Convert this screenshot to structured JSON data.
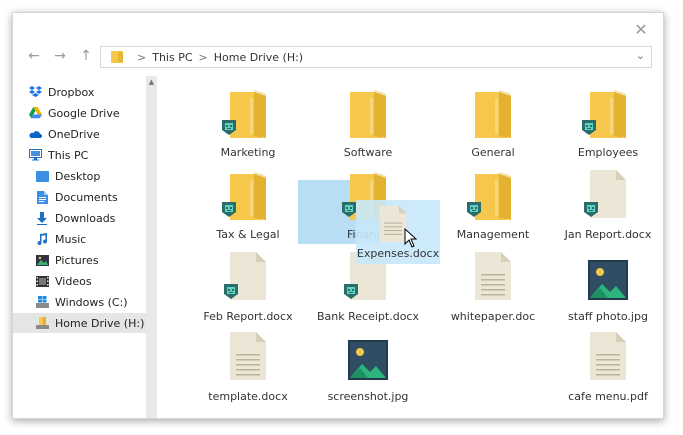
{
  "window": {
    "close_icon": "close-icon"
  },
  "nav": {
    "back_icon": "back-arrow-icon",
    "forward_icon": "forward-arrow-icon",
    "up_icon": "up-arrow-icon",
    "breadcrumb": [
      "This PC",
      "Home Drive (H:)"
    ],
    "separator": ">"
  },
  "sidebar": {
    "items": [
      {
        "label": "Dropbox",
        "icon": "dropbox-icon",
        "indent": 0
      },
      {
        "label": "Google Drive",
        "icon": "google-drive-icon",
        "indent": 0
      },
      {
        "label": "OneDrive",
        "icon": "onedrive-icon",
        "indent": 0
      },
      {
        "label": "This PC",
        "icon": "monitor-icon",
        "indent": 0
      },
      {
        "label": "Desktop",
        "icon": "desktop-folder-icon",
        "indent": 1
      },
      {
        "label": "Documents",
        "icon": "documents-icon",
        "indent": 1
      },
      {
        "label": "Downloads",
        "icon": "download-icon",
        "indent": 1
      },
      {
        "label": "Music",
        "icon": "music-icon",
        "indent": 1
      },
      {
        "label": "Pictures",
        "icon": "pictures-icon",
        "indent": 1
      },
      {
        "label": "Videos",
        "icon": "videos-icon",
        "indent": 1
      },
      {
        "label": "Windows (C:)",
        "icon": "windows-drive-icon",
        "indent": 1
      },
      {
        "label": "Home Drive (H:)",
        "icon": "home-drive-icon",
        "indent": 1,
        "active": true
      }
    ]
  },
  "files": [
    {
      "name": "Marketing",
      "type": "folder",
      "badge": true
    },
    {
      "name": "Software",
      "type": "folder",
      "badge": false
    },
    {
      "name": "General",
      "type": "folder",
      "badge": false
    },
    {
      "name": "Employees",
      "type": "folder",
      "badge": true
    },
    {
      "name": "Tax & Legal",
      "type": "folder",
      "badge": true
    },
    {
      "name": "Finance",
      "type": "folder",
      "badge": true,
      "selected": true
    },
    {
      "name": "Management",
      "type": "folder",
      "badge": true
    },
    {
      "name": "Jan Report.docx",
      "type": "doc",
      "badge": true
    },
    {
      "name": "Feb Report.docx",
      "type": "doc",
      "badge": true
    },
    {
      "name": "Bank Receipt.docx",
      "type": "doc",
      "badge": true
    },
    {
      "name": "whitepaper.doc",
      "type": "doc-lines",
      "badge": false
    },
    {
      "name": "staff photo.jpg",
      "type": "image",
      "badge": false
    },
    {
      "name": "template.docx",
      "type": "doc-lines",
      "badge": false
    },
    {
      "name": "screenshot.jpg",
      "type": "image",
      "badge": false
    },
    {
      "name": "",
      "type": "none"
    },
    {
      "name": "cafe menu.pdf",
      "type": "doc-lines",
      "badge": false
    }
  ],
  "drag": {
    "name": "Expenses.docx",
    "icon": "document-icon"
  },
  "colors": {
    "folder": "#f5c84c",
    "folder_dark": "#e3b230",
    "badge": "#2a6d6a",
    "badge_accent": "#5fd1c1",
    "selection": "#b7def5",
    "doc": "#ece6d6"
  }
}
